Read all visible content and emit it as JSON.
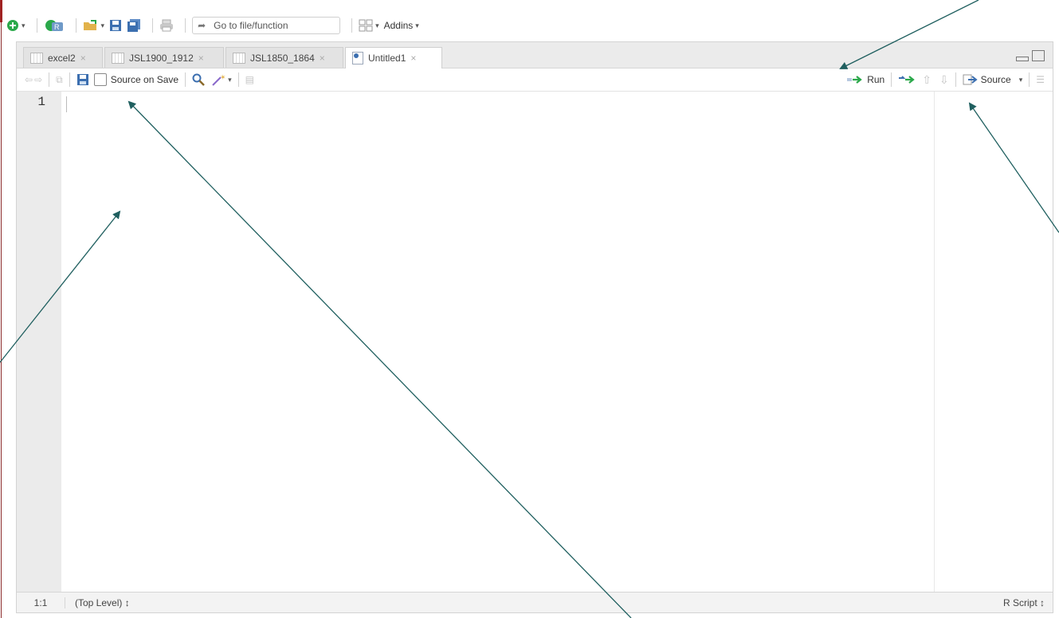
{
  "toolbar": {
    "goto_placeholder": "Go to file/function",
    "addins_label": "Addins"
  },
  "tabs": [
    {
      "label": "excel2"
    },
    {
      "label": "JSL1900_1912"
    },
    {
      "label": "JSL1850_1864"
    },
    {
      "label": "Untitled1"
    }
  ],
  "editor_toolbar": {
    "source_on_save": "Source on Save",
    "run_label": "Run",
    "source_label": "Source"
  },
  "editor": {
    "line_numbers": [
      "1"
    ]
  },
  "statusbar": {
    "position": "1:1",
    "scope": "(Top Level) ↕",
    "file_type": "R Script ↕"
  },
  "colors": {
    "arrow": "#1f5f5f",
    "run_icon": "#2aa84a",
    "save_icon": "#3c6fb0"
  }
}
